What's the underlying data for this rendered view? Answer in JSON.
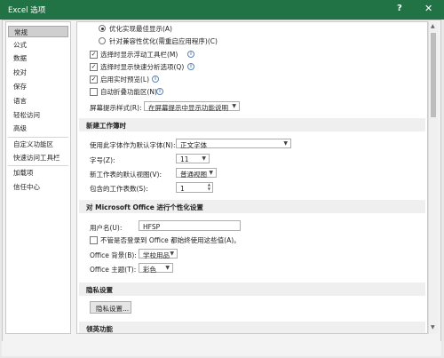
{
  "window": {
    "title": "Excel 选项",
    "help": "?",
    "close": "✕"
  },
  "sidebar": {
    "items": [
      {
        "label": "常规",
        "selected": true
      },
      {
        "label": "公式"
      },
      {
        "label": "数据"
      },
      {
        "label": "校对"
      },
      {
        "label": "保存"
      },
      {
        "label": "语言"
      },
      {
        "label": "轻松访问"
      },
      {
        "label": "高级"
      },
      {
        "label": "自定义功能区"
      },
      {
        "label": "快速访问工具栏"
      },
      {
        "label": "加载项"
      },
      {
        "label": "信任中心"
      }
    ]
  },
  "general": {
    "radio_best_display": "优化实现最佳显示(A)",
    "radio_compat": "针对兼容性优化(需重启应用程序)(C)",
    "cb_minitoolbar": "选择时显示浮动工具栏(M)",
    "cb_quick_analysis": "选择时显示快速分析选项(Q)",
    "cb_live_preview": "启用实时预览(L)",
    "cb_collapse_ribbon": "自动折叠功能区(N)",
    "screentip_label": "屏幕提示样式(R):",
    "screentip_value": "在屏幕提示中显示功能说明"
  },
  "new_workbook": {
    "section_title": "新建工作簿时",
    "font_label": "使用此字体作为默认字体(N):",
    "font_value": "正文字体",
    "size_label": "字号(Z):",
    "size_value": "11",
    "view_label": "新工作表的默认视图(V):",
    "view_value": "普通视图",
    "sheets_label": "包含的工作表数(S):",
    "sheets_value": "1"
  },
  "personalize": {
    "section_title": "对 Microsoft Office 进行个性化设置",
    "username_label": "用户名(U):",
    "username_value": "HFSP",
    "cb_always_use": "不管是否登录到 Office 都始终使用这些值(A)。",
    "background_label": "Office 背景(B):",
    "background_value": "学校用品",
    "theme_label": "Office 主题(T):",
    "theme_value": "彩色"
  },
  "privacy": {
    "section_title": "隐私设置",
    "button_label": "隐私设置..."
  },
  "startup": {
    "section_title": "领英功能"
  },
  "icons": {
    "info": "i",
    "check": "✓",
    "arrow_down": "▼",
    "arrow_up": "▲"
  }
}
